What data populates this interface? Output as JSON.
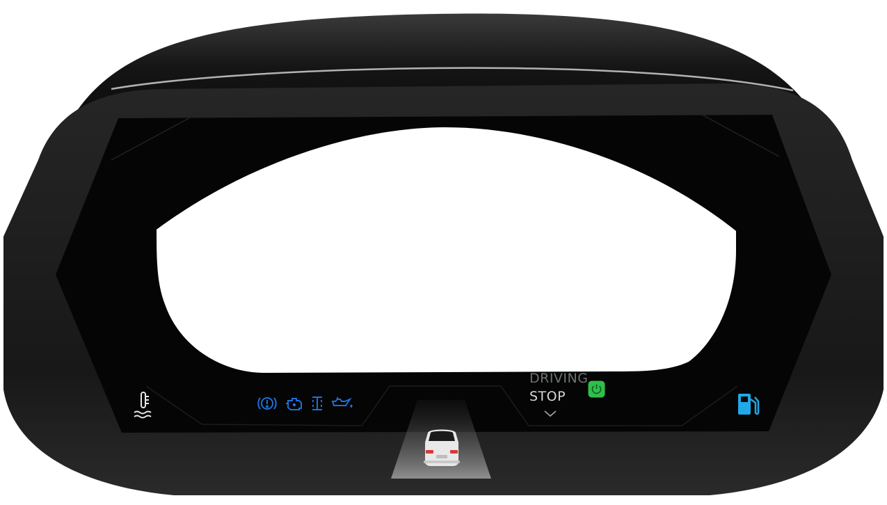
{
  "cluster": {
    "drive_mode": {
      "previous": "DRIVING",
      "current": "STOP"
    },
    "warning_indicators": [
      {
        "icon": "brake-warning-icon",
        "color": "#1e6fd9"
      },
      {
        "icon": "engine-check-icon",
        "color": "#1e6fd9"
      },
      {
        "icon": "transmission-icon",
        "color": "#1e6fd9"
      },
      {
        "icon": "oil-pressure-icon",
        "color": "#1e6fd9"
      }
    ],
    "coolant_icon": "coolant-temperature-icon",
    "fuel_icon": "fuel-pump-icon",
    "power_indicator": {
      "icon": "power-icon",
      "color": "#2fbf4a"
    },
    "vehicle_icon": "vehicle-rear-icon",
    "colors": {
      "bezel": "#1b1b1b",
      "screen": "#0a0a0a",
      "accent_blue": "#1e6fd9",
      "fuel_cyan": "#20a8e8",
      "active_green": "#2fbf4a"
    }
  }
}
